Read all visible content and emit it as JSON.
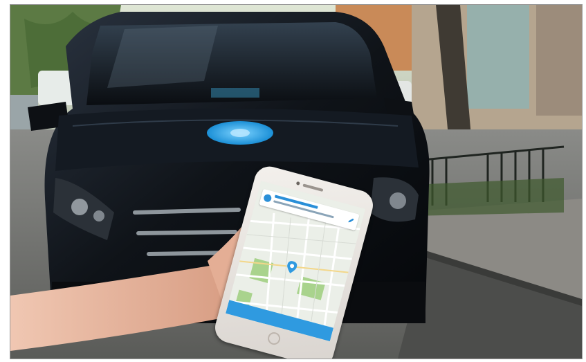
{
  "photo": {
    "subject": "hand-holding-phone-in-front-of-car",
    "colors": {
      "car_body": "#0d1014",
      "car_logo": "#2fa8e8",
      "trees": "#4d6b3a",
      "sidewalk": "#7d7a75",
      "street": "#6e6f6d",
      "skin": "#e7b49c",
      "phone_frame": "#efeae6",
      "app_accent": "#2f9ae0"
    }
  },
  "phone_app": {
    "pickup_button_label": "",
    "map_icon": "map-icon",
    "location_icon": "location-pin-icon",
    "edit_icon": "pencil-icon"
  }
}
